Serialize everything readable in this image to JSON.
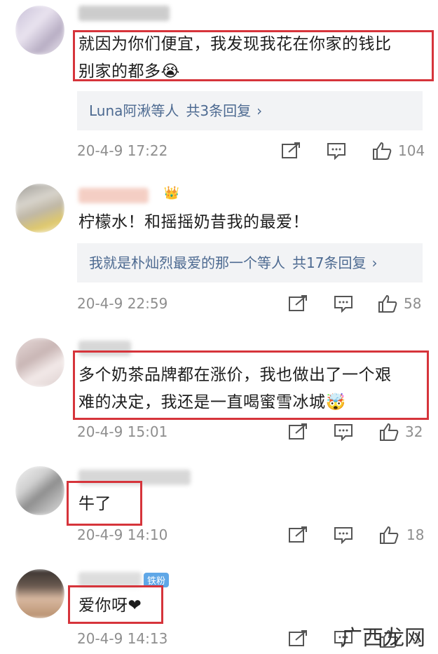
{
  "comments": [
    {
      "text_lines": [
        "就因为你们便宜，我发现我花在你家的钱比",
        "别家的都多😭"
      ],
      "replies": {
        "who": "Luna阿湫等人",
        "count": "共3条回复",
        "chev": "›"
      },
      "time": "20-4-9 17:22",
      "likes": "104"
    },
    {
      "text_lines": [
        "柠檬水！和摇摇奶昔我的最爱！"
      ],
      "replies": {
        "who": "我就是朴灿烈最爱的那一个等人",
        "count": "共17条回复",
        "chev": "›"
      },
      "time": "20-4-9 22:59",
      "likes": "58"
    },
    {
      "text_lines": [
        "多个奶茶品牌都在涨价，我也做出了一个艰",
        "难的决定，我还是一直喝蜜雪冰城🤯"
      ],
      "time": "20-4-9 15:01",
      "likes": "32"
    },
    {
      "text_lines": [
        "牛了"
      ],
      "time": "20-4-9 14:10",
      "likes": "18"
    },
    {
      "text_lines": [
        "爱你呀❤"
      ],
      "badge": "铁粉",
      "time": "20-4-9 14:13",
      "likes": "3"
    }
  ],
  "watermark": "广西龙网",
  "icons": [
    "repost-icon",
    "comment-icon",
    "like-icon"
  ],
  "colors": {
    "highlight_box": "#d6343b",
    "link": "#4d6a91",
    "meta": "#8e8e8e",
    "reply_bg": "#f2f3f5"
  }
}
